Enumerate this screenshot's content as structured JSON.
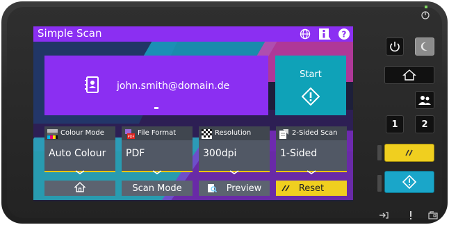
{
  "titlebar": {
    "title": "Simple Scan",
    "icons": [
      "globe-icon",
      "info-icon",
      "help-icon"
    ]
  },
  "destination": {
    "address": "john.smith@domain.de",
    "icon": "address-book-icon"
  },
  "start": {
    "label": "Start",
    "icon": "start-diamond-icon"
  },
  "settings": [
    {
      "label": "Colour Mode",
      "value": "Auto Colour",
      "icon": "colour-mode-icon"
    },
    {
      "label": "File Format",
      "value": "PDF",
      "icon": "file-format-icon"
    },
    {
      "label": "Resolution",
      "value": "300dpi",
      "icon": "resolution-icon"
    },
    {
      "label": "2-Sided Scan",
      "value": "1-Sided",
      "icon": "two-sided-icon"
    }
  ],
  "bottom_buttons": {
    "home": "",
    "scan_mode": "Scan Mode",
    "preview": "Preview",
    "reset": "Reset"
  },
  "hardware": {
    "key_1": "1",
    "key_2": "2"
  },
  "colors": {
    "accent_purple": "#8b2ff2",
    "start_teal": "#0fa2b8",
    "reset_yellow": "#f0cf1f"
  }
}
